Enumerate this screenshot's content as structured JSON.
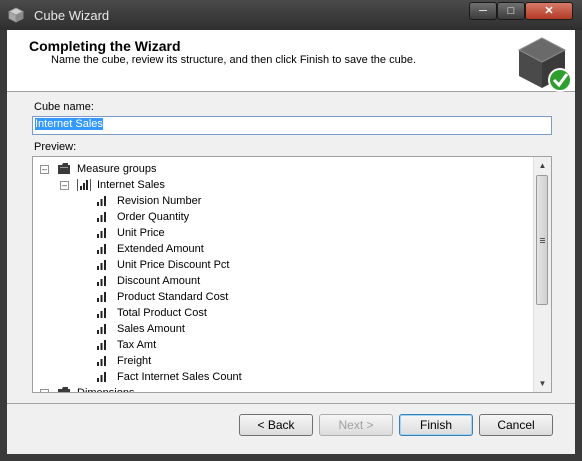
{
  "window": {
    "title": "Cube Wizard"
  },
  "header": {
    "title": "Completing the Wizard",
    "subtitle": "Name the cube, review its structure, and then click Finish to save the cube."
  },
  "form": {
    "cube_name_label": "Cube name:",
    "cube_name_value": "Internet Sales",
    "preview_label": "Preview:"
  },
  "tree": {
    "measure_groups": "Measure groups",
    "internet_sales": "Internet Sales",
    "measures": [
      "Revision Number",
      "Order Quantity",
      "Unit Price",
      "Extended Amount",
      "Unit Price Discount Pct",
      "Discount Amount",
      "Product Standard Cost",
      "Total Product Cost",
      "Sales Amount",
      "Tax Amt",
      "Freight",
      "Fact Internet Sales Count"
    ],
    "dimensions": "Dimensions"
  },
  "buttons": {
    "back": "< Back",
    "next": "Next >",
    "finish": "Finish",
    "cancel": "Cancel"
  },
  "icons": {
    "app": "cube-icon",
    "header": "cube-check-icon",
    "folder": "folder-icon",
    "measure_group": "measure-group-icon",
    "measure": "measure-bars-icon"
  },
  "colors": {
    "selection": "#3399ff",
    "check_green": "#2e9e2e"
  }
}
